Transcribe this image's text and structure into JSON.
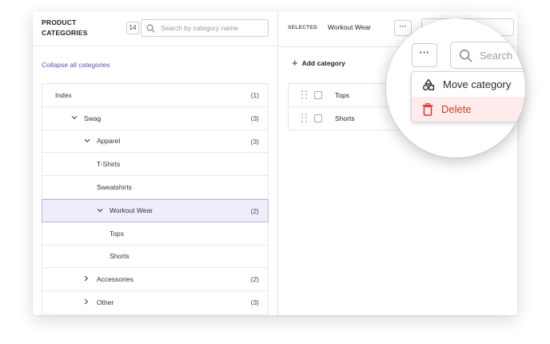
{
  "left_panel": {
    "title": "PRODUCT CATEGORIES",
    "count": "14",
    "search_placeholder": "Search by category name",
    "collapse_link": "Collapse all categories",
    "tree": [
      {
        "label": "Index",
        "count": "(1)",
        "chevron": "",
        "depth": 0
      },
      {
        "label": "Swag",
        "count": "(3)",
        "chevron": "down",
        "depth": 1
      },
      {
        "label": "Apparel",
        "count": "(3)",
        "chevron": "down",
        "depth": 2
      },
      {
        "label": "T-Shirts",
        "count": "",
        "chevron": "",
        "depth": 3
      },
      {
        "label": "Sweatshirts",
        "count": "",
        "chevron": "",
        "depth": 3
      },
      {
        "label": "Workout Wear",
        "count": "(2)",
        "chevron": "down",
        "depth": 3,
        "selected": true
      },
      {
        "label": "Tops",
        "count": "",
        "chevron": "",
        "depth": 4
      },
      {
        "label": "Shorts",
        "count": "",
        "chevron": "",
        "depth": 4
      },
      {
        "label": "Accessories",
        "count": "(2)",
        "chevron": "right",
        "depth": 2
      },
      {
        "label": "Other",
        "count": "(3)",
        "chevron": "right",
        "depth": 2
      }
    ]
  },
  "right_panel": {
    "selected_label": "SELECTED",
    "selected_value": "Workout Wear",
    "dots_label": "···",
    "add_category": "Add category",
    "rows": [
      {
        "label": "Tops"
      },
      {
        "label": "Shorts"
      }
    ]
  },
  "magnifier": {
    "dots_label": "···",
    "search_placeholder": "Search",
    "menu": [
      {
        "label": "Move category",
        "icon": "shapes-icon"
      },
      {
        "label": "Delete",
        "icon": "trash-icon"
      }
    ]
  },
  "colors": {
    "accent": "#4b44c2",
    "link": "#5a4fc4",
    "selected_bg": "#eeeefb",
    "danger": "#d23a32",
    "danger_bg": "#fdeceb"
  }
}
